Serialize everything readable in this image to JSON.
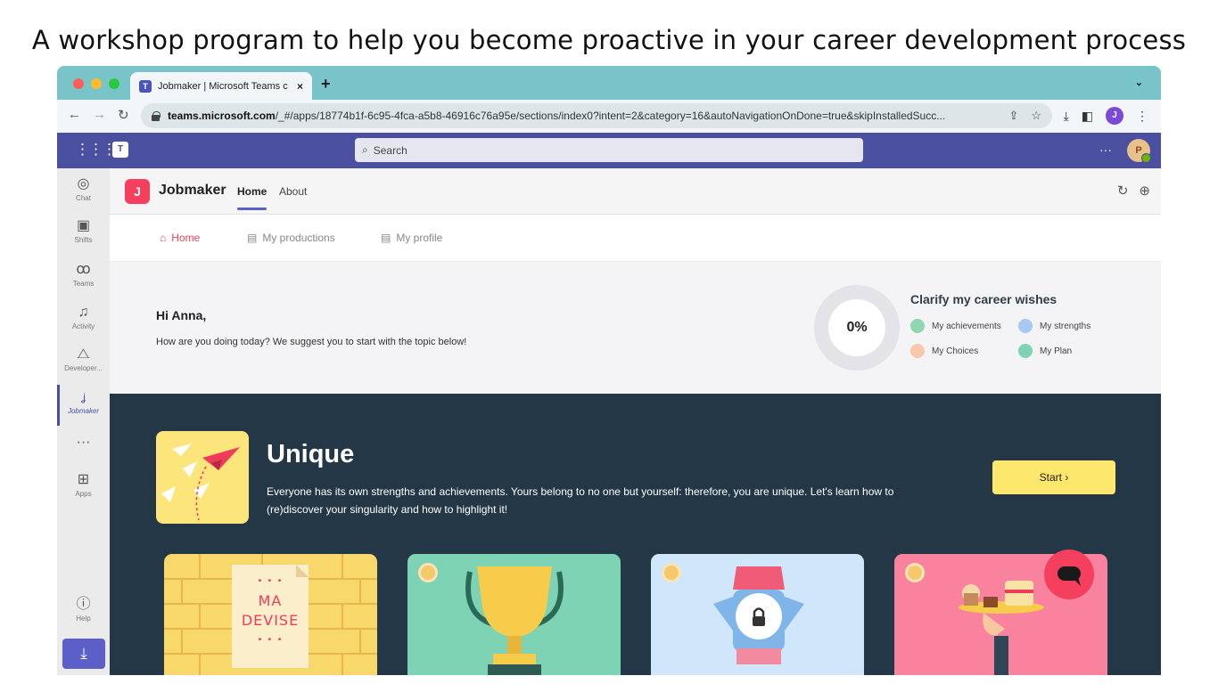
{
  "caption": "A workshop program to help you become proactive in your career development process",
  "browser": {
    "tab_title": "Jobmaker | Microsoft Teams c",
    "tab_close": "×",
    "new_tab": "+",
    "tab_menu": "⌄",
    "url_host": "teams.microsoft.com",
    "url_rest": "/_#/apps/18774b1f-6c95-4fca-a5b8-46916c76a95e/sections/index0?intent=2&category=16&autoNavigationOnDone=true&skipInstalledSucc...",
    "profile_initial": "J"
  },
  "teams": {
    "search_placeholder": "Search",
    "more": "···",
    "avatar_initial": "P",
    "rail": [
      {
        "label": "Chat",
        "icon": "chat-icon"
      },
      {
        "label": "Shifts",
        "icon": "shifts-icon"
      },
      {
        "label": "Teams",
        "icon": "teams-icon"
      },
      {
        "label": "Activity",
        "icon": "bell-icon"
      },
      {
        "label": "Developer...",
        "icon": "developer-icon"
      },
      {
        "label": "Jobmaker",
        "icon": "jobmaker-icon"
      },
      {
        "label": "Apps",
        "icon": "apps-icon"
      },
      {
        "label": "Help",
        "icon": "help-icon"
      }
    ],
    "rail_more": "···"
  },
  "app": {
    "logo_letter": "J",
    "name": "Jobmaker",
    "tabs": [
      {
        "label": "Home",
        "active": true
      },
      {
        "label": "About",
        "active": false
      }
    ],
    "subnav": [
      {
        "label": "Home",
        "icon": "house-icon",
        "active": true
      },
      {
        "label": "My productions",
        "icon": "document-icon",
        "active": false
      },
      {
        "label": "My profile",
        "icon": "document-icon",
        "active": false
      }
    ],
    "greeting": "Hi Anna,",
    "greeting_sub": "How are you doing today? We suggest you to start with the topic below!",
    "progress_text": "0%",
    "progress_value": 0,
    "clarify_title": "Clarify my career wishes",
    "clarify_items": [
      "My achievements",
      "My strengths",
      "My Choices",
      "My Plan"
    ],
    "topic": {
      "title": "Unique",
      "description": "Everyone has its own strengths and achievements. Yours belong to no one but yourself: therefore, you are unique. Let's learn how to (re)discover your singularity and how to highlight it!",
      "start_label": "Start ›"
    },
    "cards": [
      {
        "name": "devise-card",
        "color": "#f8d86a",
        "sign_dots": "• • •",
        "sign_line1": "MA",
        "sign_line2": "DEVISE"
      },
      {
        "name": "trophy-card",
        "color": "#7fd3b5"
      },
      {
        "name": "superhero-card",
        "color": "#cfe6fb"
      },
      {
        "name": "cake-card",
        "color": "#f9829e"
      }
    ]
  },
  "colors": {
    "accent": "#f43f5e",
    "teams_purple": "#4a4fa0",
    "dark_panel": "#233746",
    "start_button": "#fde76c"
  }
}
